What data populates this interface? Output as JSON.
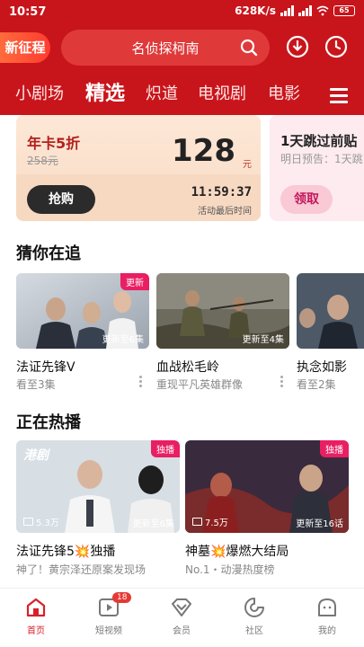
{
  "status_bar": {
    "time": "10:57",
    "speed": "628K/s",
    "battery": "65"
  },
  "header": {
    "new_campaign": "新征程",
    "search_text": "名侦探柯南",
    "tabs": [
      "小剧场",
      "精选",
      "炽道",
      "电视剧",
      "电影"
    ],
    "active_tab": "精选"
  },
  "promo": {
    "card1": {
      "title": "年卡5折",
      "old_price": "258元",
      "price": "128",
      "unit": "元",
      "button": "抢购",
      "timer": "11:59:37",
      "timer_label": "活动最后时间"
    },
    "card2": {
      "title": "1天跳过前贴",
      "subtitle": "明日预告：1天跳",
      "button": "领取"
    }
  },
  "guess": {
    "title": "猜你在追",
    "items": [
      {
        "title": "法证先锋V",
        "subtitle": "看至3集",
        "update": "更新至6集",
        "badge": "更新"
      },
      {
        "title": "血战松毛岭",
        "subtitle": "重现平凡英雄群像",
        "update": "更新至4集"
      },
      {
        "title": "执念如影",
        "subtitle": "看至2集"
      }
    ]
  },
  "hot": {
    "title": "正在热播",
    "items": [
      {
        "title": "法证先锋5💥独播",
        "subtitle": "神了！黄宗泽还原案发现场",
        "views": "5.3万",
        "update": "更新至6集",
        "badge": "独播",
        "overlay": "港剧"
      },
      {
        "title": "神墓💥爆燃大结局",
        "subtitle": "No.1・动漫热度榜",
        "views": "7.5万",
        "update": "更新至16话",
        "badge": "独播"
      }
    ]
  },
  "bottom_nav": [
    {
      "label": "首页",
      "active": true
    },
    {
      "label": "短视频",
      "badge": "18"
    },
    {
      "label": "会员"
    },
    {
      "label": "社区"
    },
    {
      "label": "我的"
    }
  ],
  "colors": {
    "brand_red": "#c8151b",
    "badge_pink": "#e91e63"
  },
  "icons": [
    "search-icon",
    "download-icon",
    "history-icon",
    "menu-icon",
    "home-icon",
    "video-icon",
    "vip-icon",
    "community-icon",
    "profile-icon",
    "views-icon",
    "more-icon"
  ]
}
